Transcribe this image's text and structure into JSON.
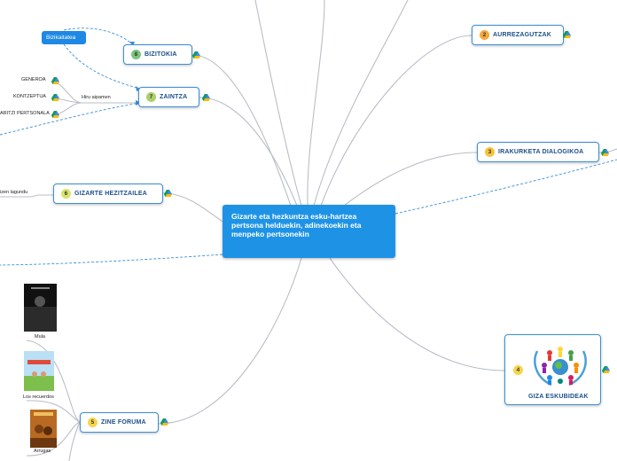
{
  "root": {
    "label": "Gizarte eta hezkuntza esku-hartzea pertsona helduekin, adinekoekin eta menpeko pertsonekin"
  },
  "topics": [
    {
      "number": "2",
      "label": "AURREZAGUTZAK",
      "badge_color": "#f4a93a"
    },
    {
      "number": "3",
      "label": "IRAKURKETA DIALOGIKOA",
      "badge_color": "#f7c33c"
    },
    {
      "number": "4",
      "label": "GIZA ESKUBIDEAK",
      "badge_color": "#f7d44a"
    },
    {
      "number": "5",
      "label": "ZINE FORUMA",
      "badge_color": "#f7d44a"
    },
    {
      "number": "6",
      "label": "GIZARTE HEZITZAILEA",
      "badge_color": "#d8e36a"
    },
    {
      "number": "7",
      "label": "ZAINTZA",
      "badge_color": "#a9d06a"
    },
    {
      "number": "8",
      "label": "BIZITOKIA",
      "badge_color": "#7cc47a"
    }
  ],
  "zaintza": {
    "hub_label": "Hiru aipamen",
    "leaves": [
      "GENEROA",
      "KONTZEPTUA",
      "ARITZI PERTSONALA"
    ]
  },
  "bizitokia_tag": "Bizikaitatea",
  "gizarte_leaf": "izen lagundu",
  "films": [
    "Mula",
    "Los recuerdos",
    "Arrugas"
  ],
  "colors": {
    "accent": "#1e93e6",
    "branch": "#b9bec6",
    "dashed": "#3b8fd6"
  },
  "icons": [
    "google-drive-icon",
    "un-emblem-icon"
  ]
}
